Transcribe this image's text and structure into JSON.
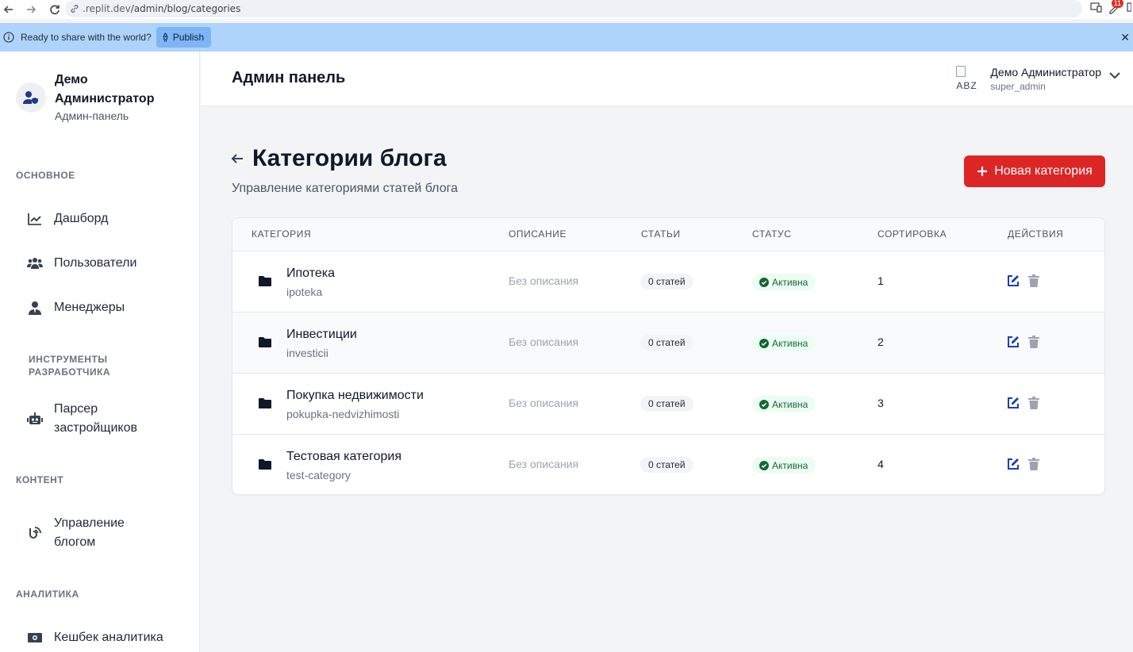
{
  "browser": {
    "url_prefix": ".replit.dev",
    "url_path": "/admin/blog/categories",
    "notification_count": "11"
  },
  "publish_bar": {
    "message": "Ready to share with the world?",
    "button_label": "Publish"
  },
  "sidebar": {
    "profile": {
      "name": "Демо Администратор",
      "role": "Админ-панель"
    },
    "sections": [
      {
        "title": "ОСНОВНОЕ"
      },
      {
        "title": "ИНСТРУМЕНТЫ РАЗРАБОТЧИКА"
      },
      {
        "title": "КОНТЕНТ"
      },
      {
        "title": "АНАЛИТИКА"
      }
    ],
    "items": [
      {
        "label": "Дашборд",
        "icon": "chart-line-icon"
      },
      {
        "label": "Пользователи",
        "icon": "users-icon"
      },
      {
        "label": "Менеджеры",
        "icon": "user-tie-icon"
      },
      {
        "label": "Парсер застройщиков",
        "icon": "robot-icon"
      },
      {
        "label": "Управление блогом",
        "icon": "blog-icon"
      },
      {
        "label": "Кешбек аналитика",
        "icon": "money-icon"
      }
    ]
  },
  "header": {
    "title": "Админ панель",
    "user": {
      "name": "Демо Администратор",
      "role": "super_admin",
      "avatar_alt": "ABZ"
    }
  },
  "page": {
    "title": "Категории блога",
    "subtitle": "Управление категориями статей блога",
    "new_button": "Новая категория"
  },
  "table": {
    "columns": [
      "Категория",
      "Описание",
      "Статьи",
      "Статус",
      "Сортировка",
      "Действия"
    ],
    "rows": [
      {
        "name": "Ипотека",
        "slug": "ipoteka",
        "description": "Без описания",
        "articles": "0 статей",
        "status": "Активна",
        "sort": "1"
      },
      {
        "name": "Инвестиции",
        "slug": "investicii",
        "description": "Без описания",
        "articles": "0 статей",
        "status": "Активна",
        "sort": "2"
      },
      {
        "name": "Покупка недвижимости",
        "slug": "pokupka-nedvizhimosti",
        "description": "Без описания",
        "articles": "0 статей",
        "status": "Активна",
        "sort": "3"
      },
      {
        "name": "Тестовая категория",
        "slug": "test-category",
        "description": "Без описания",
        "articles": "0 статей",
        "status": "Активна",
        "sort": "4"
      }
    ]
  },
  "colors": {
    "accent_red": "#dc2626",
    "edit_blue": "#1e40af",
    "status_green": "#166534",
    "publish_bar": "#afd4fb"
  }
}
